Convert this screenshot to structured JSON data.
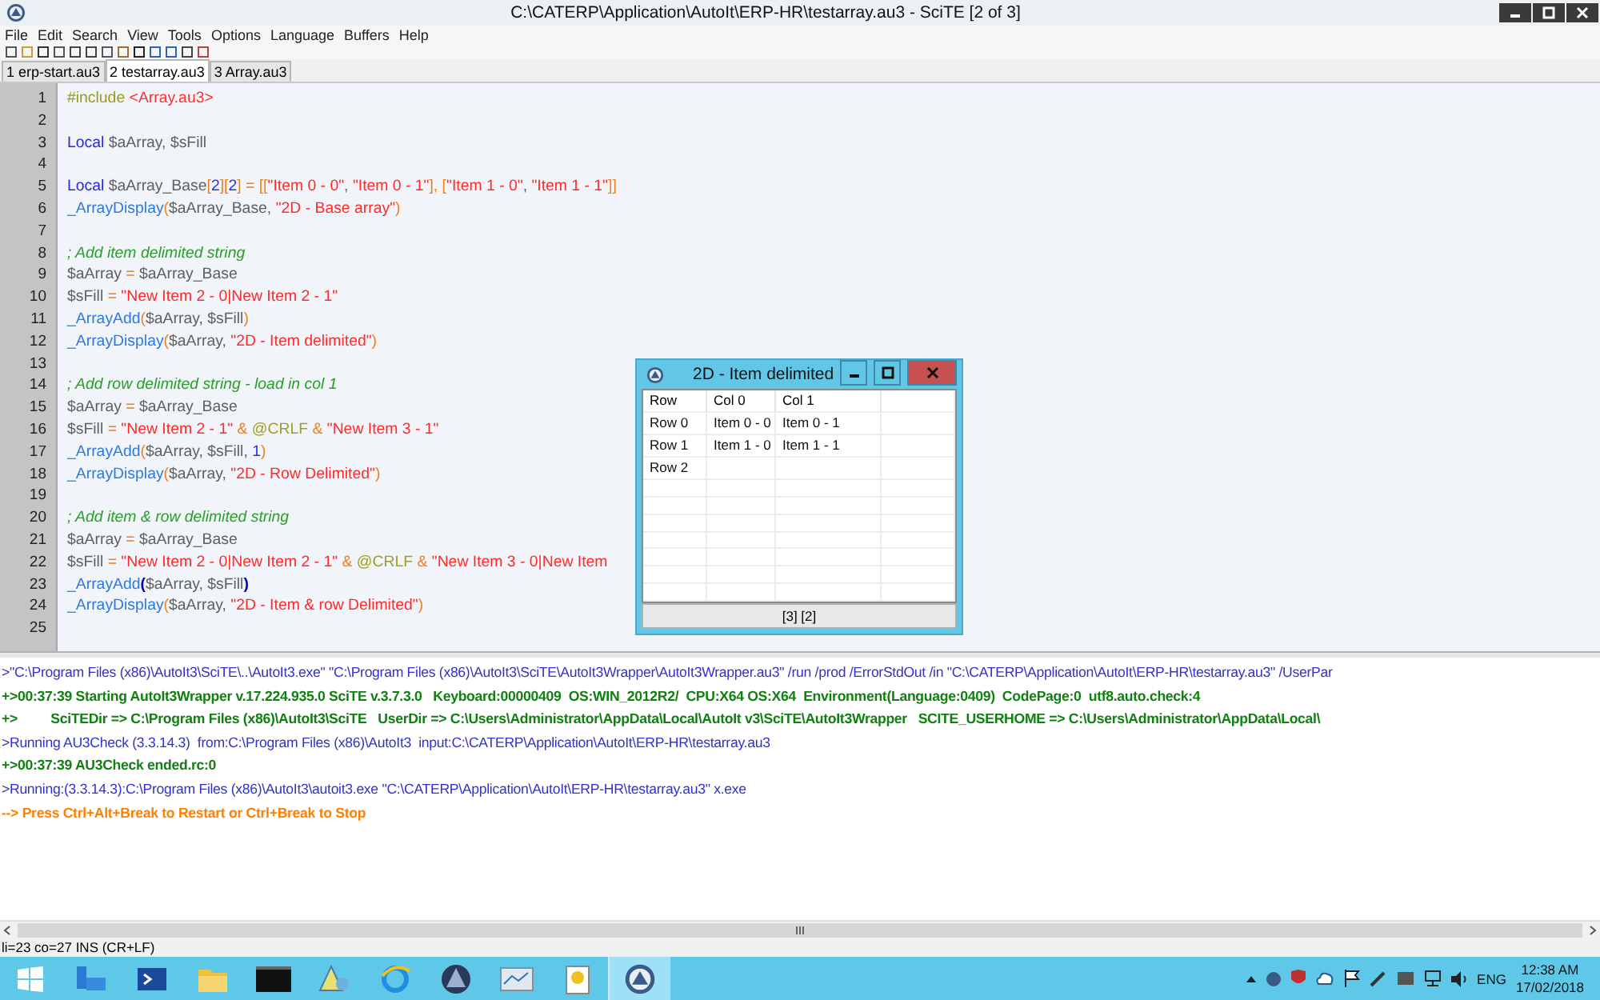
{
  "window": {
    "title": "C:\\CATERP\\Application\\AutoIt\\ERP-HR\\testarray.au3 - SciTE [2 of 3]"
  },
  "menu": [
    "File",
    "Edit",
    "Search",
    "View",
    "Tools",
    "Options",
    "Language",
    "Buffers",
    "Help"
  ],
  "tabs": [
    {
      "label": "1 erp-start.au3",
      "selected": false
    },
    {
      "label": "2 testarray.au3",
      "selected": true
    },
    {
      "label": "3 Array.au3",
      "selected": false
    }
  ],
  "editor": {
    "lines": [
      {
        "number": "1",
        "tokens": [
          {
            "kind": "directive",
            "text": "#include "
          },
          {
            "kind": "include",
            "text": "<Array.au3>"
          }
        ]
      },
      {
        "number": "2"
      },
      {
        "number": "3",
        "tokens": [
          {
            "kind": "keyword",
            "text": "Local "
          },
          {
            "kind": "variable",
            "text": "$aArray, $sFill"
          }
        ]
      },
      {
        "number": "4"
      },
      {
        "number": "5",
        "tokens": [
          {
            "kind": "keyword",
            "text": "Local "
          },
          {
            "kind": "variable",
            "text": "$aArray_Base"
          },
          {
            "kind": "operator",
            "text": "["
          },
          {
            "kind": "number",
            "text": "2"
          },
          {
            "kind": "operator",
            "text": "]["
          },
          {
            "kind": "number",
            "text": "2"
          },
          {
            "kind": "operator",
            "text": "] = [["
          },
          {
            "kind": "string",
            "text": "\"Item 0 - 0\""
          },
          {
            "kind": "variable",
            "text": ", "
          },
          {
            "kind": "string",
            "text": "\"Item 0 - 1\""
          },
          {
            "kind": "operator",
            "text": "], ["
          },
          {
            "kind": "string",
            "text": "\"Item 1 - 0\""
          },
          {
            "kind": "variable",
            "text": ", "
          },
          {
            "kind": "string",
            "text": "\"Item 1 - 1\""
          },
          {
            "kind": "operator",
            "text": "]]"
          }
        ]
      },
      {
        "number": "6",
        "tokens": [
          {
            "kind": "function",
            "text": "_ArrayDisplay"
          },
          {
            "kind": "operator",
            "text": "("
          },
          {
            "kind": "variable",
            "text": "$aArray_Base, "
          },
          {
            "kind": "string",
            "text": "\"2D - Base array\""
          },
          {
            "kind": "operator",
            "text": ")"
          }
        ]
      },
      {
        "number": "7"
      },
      {
        "number": "8",
        "tokens": [
          {
            "kind": "comment",
            "text": "; Add item delimited string"
          }
        ]
      },
      {
        "number": "9",
        "tokens": [
          {
            "kind": "variable",
            "text": "$aArray "
          },
          {
            "kind": "operator",
            "text": "= "
          },
          {
            "kind": "variable",
            "text": "$aArray_Base"
          }
        ]
      },
      {
        "number": "10",
        "tokens": [
          {
            "kind": "variable",
            "text": "$sFill "
          },
          {
            "kind": "operator",
            "text": "= "
          },
          {
            "kind": "string",
            "text": "\"New Item 2 - 0|New Item 2 - 1\""
          }
        ]
      },
      {
        "number": "11",
        "tokens": [
          {
            "kind": "function",
            "text": "_ArrayAdd"
          },
          {
            "kind": "operator",
            "text": "("
          },
          {
            "kind": "variable",
            "text": "$aArray, $sFill"
          },
          {
            "kind": "operator",
            "text": ")"
          }
        ]
      },
      {
        "number": "12",
        "tokens": [
          {
            "kind": "function",
            "text": "_ArrayDisplay"
          },
          {
            "kind": "operator",
            "text": "("
          },
          {
            "kind": "variable",
            "text": "$aArray, "
          },
          {
            "kind": "string",
            "text": "\"2D - Item delimited\""
          },
          {
            "kind": "operator",
            "text": ")"
          }
        ]
      },
      {
        "number": "13"
      },
      {
        "number": "14",
        "tokens": [
          {
            "kind": "comment",
            "text": "; Add row delimited string - load in col 1"
          }
        ]
      },
      {
        "number": "15",
        "tokens": [
          {
            "kind": "variable",
            "text": "$aArray "
          },
          {
            "kind": "operator",
            "text": "= "
          },
          {
            "kind": "variable",
            "text": "$aArray_Base"
          }
        ]
      },
      {
        "number": "16",
        "tokens": [
          {
            "kind": "variable",
            "text": "$sFill "
          },
          {
            "kind": "operator",
            "text": "= "
          },
          {
            "kind": "string",
            "text": "\"New Item 2 - 1\" "
          },
          {
            "kind": "operator",
            "text": "& "
          },
          {
            "kind": "macro",
            "text": "@CRLF "
          },
          {
            "kind": "operator",
            "text": "& "
          },
          {
            "kind": "string",
            "text": "\"New Item 3 - 1\""
          }
        ]
      },
      {
        "number": "17",
        "tokens": [
          {
            "kind": "function",
            "text": "_ArrayAdd"
          },
          {
            "kind": "operator",
            "text": "("
          },
          {
            "kind": "variable",
            "text": "$aArray, $sFill, "
          },
          {
            "kind": "number",
            "text": "1"
          },
          {
            "kind": "operator",
            "text": ")"
          }
        ]
      },
      {
        "number": "18",
        "tokens": [
          {
            "kind": "function",
            "text": "_ArrayDisplay"
          },
          {
            "kind": "operator",
            "text": "("
          },
          {
            "kind": "variable",
            "text": "$aArray, "
          },
          {
            "kind": "string",
            "text": "\"2D - Row Delimited\""
          },
          {
            "kind": "operator",
            "text": ")"
          }
        ]
      },
      {
        "number": "19"
      },
      {
        "number": "20",
        "tokens": [
          {
            "kind": "comment",
            "text": "; Add item & row delimited string"
          }
        ]
      },
      {
        "number": "21",
        "tokens": [
          {
            "kind": "variable",
            "text": "$aArray "
          },
          {
            "kind": "operator",
            "text": "= "
          },
          {
            "kind": "variable",
            "text": "$aArray_Base"
          }
        ]
      },
      {
        "number": "22",
        "tokens": [
          {
            "kind": "variable",
            "text": "$sFill "
          },
          {
            "kind": "operator",
            "text": "= "
          },
          {
            "kind": "string",
            "text": "\"New Item 2 - 0|New Item 2 - 1\" "
          },
          {
            "kind": "operator",
            "text": "& "
          },
          {
            "kind": "macro",
            "text": "@CRLF "
          },
          {
            "kind": "operator",
            "text": "& "
          },
          {
            "kind": "string",
            "text": "\"New Item 3 - 0|New Item"
          }
        ]
      },
      {
        "number": "23",
        "tokens": [
          {
            "kind": "function",
            "text": "_ArrayAdd"
          },
          {
            "kind": "brace",
            "text": "("
          },
          {
            "kind": "variable",
            "text": "$aArray, $sFill"
          },
          {
            "kind": "brace",
            "text": ")"
          }
        ]
      },
      {
        "number": "24",
        "tokens": [
          {
            "kind": "function",
            "text": "_ArrayDisplay"
          },
          {
            "kind": "operator",
            "text": "("
          },
          {
            "kind": "variable",
            "text": "$aArray, "
          },
          {
            "kind": "string",
            "text": "\"2D - Item & row Delimited\""
          },
          {
            "kind": "operator",
            "text": ")"
          }
        ]
      },
      {
        "number": "25"
      }
    ]
  },
  "dialog": {
    "title": "2D - Item delimited",
    "columns": [
      "Row",
      "Col 0",
      "Col 1"
    ],
    "rows": [
      [
        "Row 0",
        "Item 0 - 0",
        "Item 0 - 1"
      ],
      [
        "Row 1",
        "Item 1 - 0",
        "Item 1 - 1"
      ],
      [
        "Row 2"
      ]
    ],
    "footer": "[3] [2]"
  },
  "output": [
    {
      "kind": "command",
      "text": ">\"C:\\Program Files (x86)\\AutoIt3\\SciTE\\..\\AutoIt3.exe\" \"C:\\Program Files (x86)\\AutoIt3\\SciTE\\AutoIt3Wrapper\\AutoIt3Wrapper.au3\" /run /prod /ErrorStdOut /in \"C:\\CATERP\\Application\\AutoIt\\ERP-HR\\testarray.au3\" /UserPar"
    },
    {
      "kind": "info",
      "text": "+>00:37:39 Starting AutoIt3Wrapper v.17.224.935.0 SciTE v.3.7.3.0   Keyboard:00000409  OS:WIN_2012R2/  CPU:X64 OS:X64  Environment(Language:0409)  CodePage:0  utf8.auto.check:4"
    },
    {
      "kind": "info",
      "text": "+>         SciTEDir => C:\\Program Files (x86)\\AutoIt3\\SciTE   UserDir => C:\\Users\\Administrator\\AppData\\Local\\AutoIt v3\\SciTE\\AutoIt3Wrapper   SCITE_USERHOME => C:\\Users\\Administrator\\AppData\\Local\\"
    },
    {
      "kind": "command",
      "text": ">Running AU3Check (3.3.14.3)  from:C:\\Program Files (x86)\\AutoIt3  input:C:\\CATERP\\Application\\AutoIt\\ERP-HR\\testarray.au3"
    },
    {
      "kind": "info",
      "text": "+>00:37:39 AU3Check ended.rc:0"
    },
    {
      "kind": "command",
      "text": ">Running:(3.3.14.3):C:\\Program Files (x86)\\AutoIt3\\autoit3.exe \"C:\\CATERP\\Application\\AutoIt\\ERP-HR\\testarray.au3\" x.exe"
    },
    {
      "kind": "hint",
      "text": "--> Press Ctrl+Alt+Break to Restart or Ctrl+Break to Stop"
    }
  ],
  "status_bar": "li=23 co=27 INS (CR+LF)",
  "taskbar": {
    "apps": [
      {
        "selected": false
      },
      {
        "selected": false
      },
      {
        "selected": false
      },
      {
        "selected": false
      },
      {
        "selected": false
      },
      {
        "selected": false
      },
      {
        "selected": false
      },
      {
        "selected": false
      },
      {
        "selected": false
      },
      {
        "selected": true
      }
    ],
    "language": "ENG",
    "time": "12:38 AM",
    "date": "17/02/2018"
  }
}
